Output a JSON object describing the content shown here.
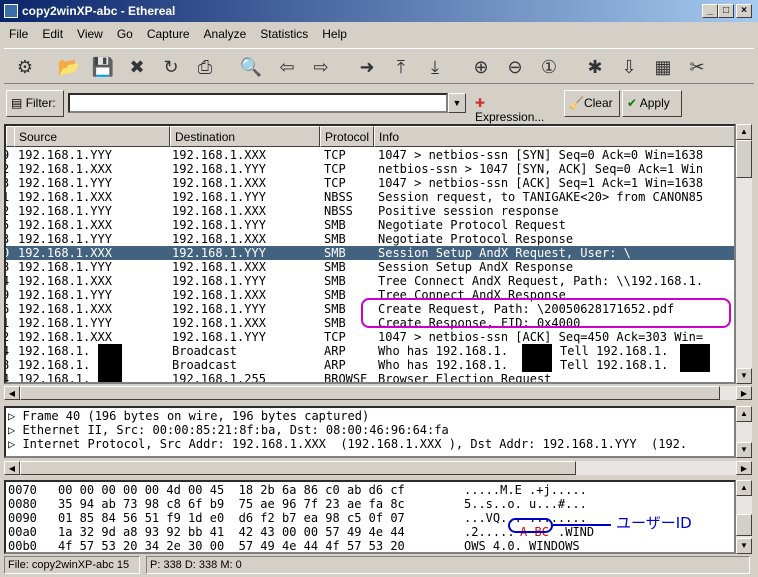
{
  "window": {
    "title": "copy2winXP-abc - Ethereal"
  },
  "menu": [
    "File",
    "Edit",
    "View",
    "Go",
    "Capture",
    "Analyze",
    "Statistics",
    "Help"
  ],
  "toolbar_icons": [
    "open-interfaces-icon",
    "open-file-icon",
    "save-icon",
    "close-icon",
    "reload-icon",
    "print-icon",
    "find-icon",
    "back-icon",
    "forward-icon",
    "go-to-icon",
    "first-icon",
    "last-icon",
    "zoom-in-icon",
    "zoom-out-icon",
    "zoom-100-icon",
    "capture-filter-icon",
    "display-filter-icon",
    "coloring-icon",
    "preferences-icon"
  ],
  "filter": {
    "label": "Filter:",
    "value": "",
    "expression": "Expression...",
    "clear": "Clear",
    "apply": "Apply"
  },
  "packet_list": {
    "columns": [
      "Source",
      "Destination",
      "Protocol",
      "Info"
    ],
    "rows": [
      {
        "no": "9",
        "src": "192.168.1.YYY",
        "dst": "192.168.1.XXX",
        "proto": "TCP",
        "info": "1047 > netbios-ssn [SYN] Seq=0 Ack=0 Win=1638"
      },
      {
        "no": "2",
        "src": "192.168.1.XXX",
        "dst": "192.168.1.YYY",
        "proto": "TCP",
        "info": "netbios-ssn > 1047 [SYN, ACK] Seq=0 Ack=1 Win"
      },
      {
        "no": "3",
        "src": "192.168.1.YYY",
        "dst": "192.168.1.XXX",
        "proto": "TCP",
        "info": "1047 > netbios-ssn [ACK] Seq=1 Ack=1 Win=1638"
      },
      {
        "no": "1",
        "src": "192.168.1.XXX",
        "dst": "192.168.1.YYY",
        "proto": "NBSS",
        "info": "Session request, to TANIGAKE<20> from CANON85"
      },
      {
        "no": "2",
        "src": "192.168.1.YYY",
        "dst": "192.168.1.XXX",
        "proto": "NBSS",
        "info": "Positive session response"
      },
      {
        "no": "5",
        "src": "192.168.1.XXX",
        "dst": "192.168.1.YYY",
        "proto": "SMB",
        "info": "Negotiate Protocol Request"
      },
      {
        "no": "3",
        "src": "192.168.1.YYY",
        "dst": "192.168.1.XXX",
        "proto": "SMB",
        "info": "Negotiate Protocol Response"
      },
      {
        "no": "0",
        "src": "192.168.1.XXX",
        "dst": "192.168.1.YYY",
        "proto": "SMB",
        "info": "Session Setup AndX Request, User: \\",
        "selected": true
      },
      {
        "no": "8",
        "src": "192.168.1.YYY",
        "dst": "192.168.1.XXX",
        "proto": "SMB",
        "info": "Session Setup AndX Response"
      },
      {
        "no": "4",
        "src": "192.168.1.XXX",
        "dst": "192.168.1.YYY",
        "proto": "SMB",
        "info": "Tree Connect AndX Request, Path: \\\\192.168.1."
      },
      {
        "no": "9",
        "src": "192.168.1.YYY",
        "dst": "192.168.1.XXX",
        "proto": "SMB",
        "info": "Tree Connect AndX Response"
      },
      {
        "no": "6",
        "src": "192.168.1.XXX",
        "dst": "192.168.1.YYY",
        "proto": "SMB",
        "info": "Create Request, Path: \\20050628171652.pdf"
      },
      {
        "no": "1",
        "src": "192.168.1.YYY",
        "dst": "192.168.1.XXX",
        "proto": "SMB",
        "info": "Create Response, FID: 0x4000"
      },
      {
        "no": "2",
        "src": "192.168.1.XXX",
        "dst": "192.168.1.YYY",
        "proto": "TCP",
        "info": "1047 > netbios-ssn [ACK] Seq=450 Ack=303 Win="
      },
      {
        "no": "4",
        "src": "192.168.1.",
        "dst": "Broadcast",
        "proto": "ARP",
        "info": "Who has 192.168.1.",
        "info2": "Tell 192.168.1."
      },
      {
        "no": "8",
        "src": "192.168.1.",
        "dst": "Broadcast",
        "proto": "ARP",
        "info": "Who has 192.168.1.",
        "info2": "Tell 192.168.1."
      },
      {
        "no": "4",
        "src": "192.168.1.",
        "dst": "192.168.1.255",
        "proto": "BROWSE",
        "info": "Browser Election Request"
      }
    ]
  },
  "details": [
    "Frame 40 (196 bytes on wire, 196 bytes captured)",
    "Ethernet II, Src: 00:00:85:21:8f:ba, Dst: 08:00:46:96:64:fa",
    "Internet Protocol, Src Addr: 192.168.1.XXX  (192.168.1.XXX ), Dst Addr: 192.168.1.YYY  (192."
  ],
  "bytes": [
    {
      "off": "0070",
      "hex": "00 00 00 00 00 4d 00 45  18 2b 6a 86 c0 ab d6 cf",
      "ascii": ".....M.E .+j....."
    },
    {
      "off": "0080",
      "hex": "35 94 ab 73 98 c8 6f b9  75 ae 96 7f 23 ae fa 8c",
      "ascii": "5..s..o. u...#..."
    },
    {
      "off": "0090",
      "hex": "01 85 84 56 51 f9 1d e0  d6 f2 b7 ea 98 c5 0f 07",
      "ascii": "...VQ... ........"
    },
    {
      "off": "00a0",
      "hex": "1a 32 9d a8 93 92 bb 41  42 43 00 00 57 49 4e 44",
      "ascii": ".2.....",
      "ascii_hl": "A BC",
      "ascii_end": ".WIND"
    },
    {
      "off": "00b0",
      "hex": "4f 57 53 20 34 2e 30 00  57 49 4e 44 4f 57 53 20",
      "ascii": "OWS 4.0. WINDOWS"
    },
    {
      "off": "00c0",
      "hex": "34 2e 30 00",
      "ascii": "4.0."
    }
  ],
  "annotation": {
    "label": "ユーザーID",
    "color": "#0000cc",
    "highlight_color": "#cc00cc"
  },
  "status": {
    "file": "File: copy2winXP-abc 15",
    "packets": "P: 338 D: 338 M: 0"
  }
}
